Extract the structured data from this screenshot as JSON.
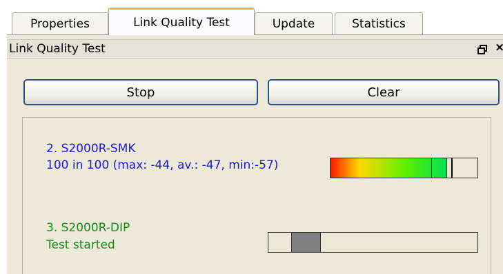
{
  "tabs": [
    {
      "label": "Properties"
    },
    {
      "label": "Link Quality Test"
    },
    {
      "label": "Update"
    },
    {
      "label": "Statistics"
    }
  ],
  "panel": {
    "title": "Link Quality Test",
    "restore_icon": "restore-window-icon",
    "close_icon": "close-icon",
    "close_glyph": "×"
  },
  "buttons": {
    "stop_label": "Stop",
    "clear_label": "Clear"
  },
  "devices": [
    {
      "name": "2. S2000R-SMK",
      "status": "100 in 100 (max: -44, av.: -47, min:-57)",
      "color": "#1c18e0",
      "signal_fill_percent": 79,
      "marker_percent": 82
    },
    {
      "name": "3. S2000R-DIP",
      "status": "Test started",
      "color": "#1a8a1a",
      "progress_start_percent": 11,
      "progress_end_percent": 25
    }
  ]
}
